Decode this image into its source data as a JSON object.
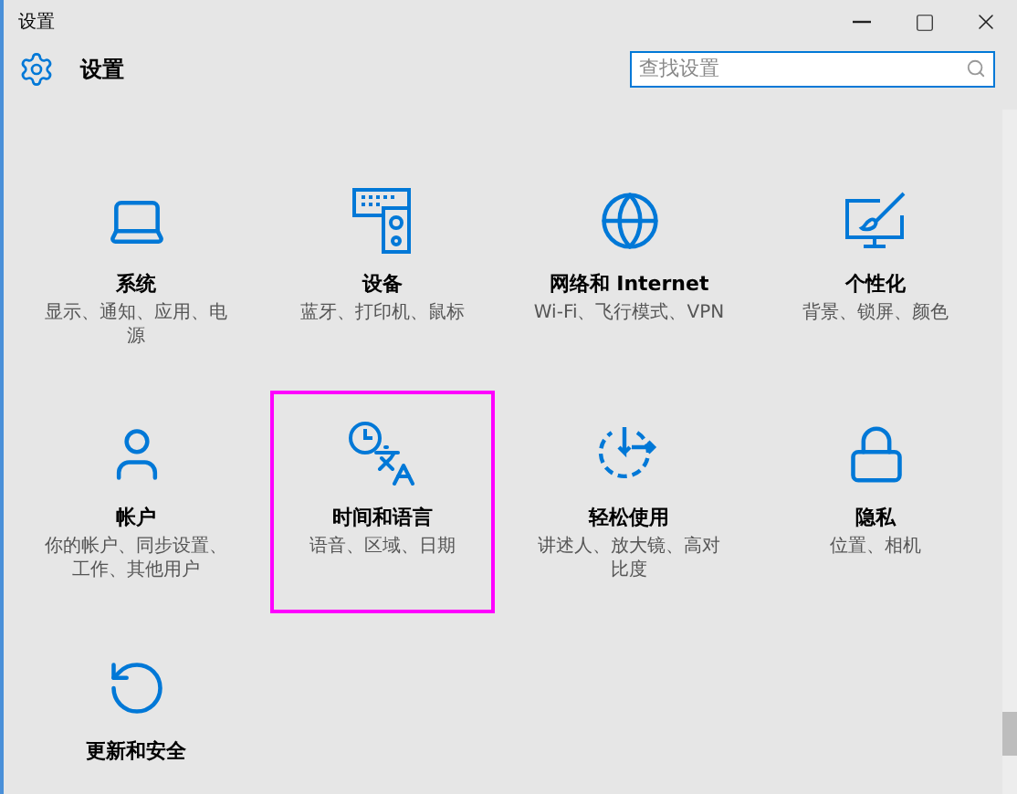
{
  "window": {
    "title": "设置"
  },
  "header": {
    "title": "设置",
    "search": {
      "placeholder": "查找设置"
    }
  },
  "tiles": [
    {
      "kind": "system",
      "title": "系统",
      "description": "显示、通知、应用、电源",
      "selected": false
    },
    {
      "kind": "devices",
      "title": "设备",
      "description": "蓝牙、打印机、鼠标",
      "selected": false
    },
    {
      "kind": "network",
      "title": "网络和 Internet",
      "description": "Wi-Fi、飞行模式、VPN",
      "selected": false
    },
    {
      "kind": "personalization",
      "title": "个性化",
      "description": "背景、锁屏、颜色",
      "selected": false
    },
    {
      "kind": "accounts",
      "title": "帐户",
      "description": "你的帐户、同步设置、工作、其他用户",
      "selected": false
    },
    {
      "kind": "time",
      "title": "时间和语言",
      "description": "语音、区域、日期",
      "selected": true
    },
    {
      "kind": "ease",
      "title": "轻松使用",
      "description": "讲述人、放大镜、高对比度",
      "selected": false
    },
    {
      "kind": "privacy",
      "title": "隐私",
      "description": "位置、相机",
      "selected": false
    },
    {
      "kind": "update",
      "title": "更新和安全",
      "selected": false
    }
  ]
}
